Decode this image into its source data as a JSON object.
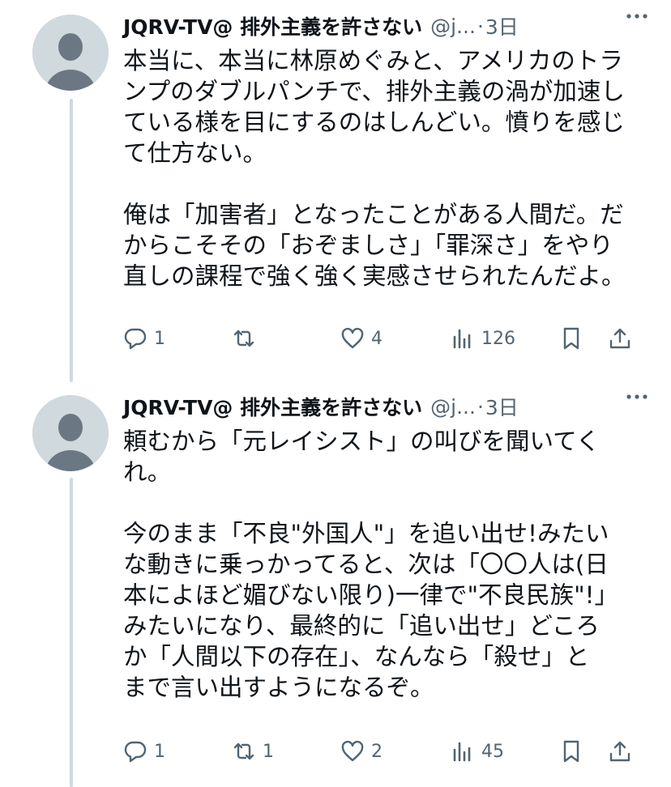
{
  "tweets": [
    {
      "author_name": "JQRV-TV@ 排外主義を許さない",
      "handle": "@j...",
      "separator": "·",
      "time": "3日",
      "lines": [
        "本当に、本当に林原めぐみと、アメリカのトラ",
        "ンプのダブルパンチで、排外主義の渦が加速し",
        "ている様を目にするのはしんどい。憤りを感じ",
        "て仕方ない。",
        "",
        "俺は「加害者」となったことがある人間だ。だ",
        "からこそその「おぞましさ」「罪深さ」をやり",
        "直しの課程で強く強く実感させられたんだよ。"
      ],
      "reply_count": "1",
      "retweet_count": "",
      "like_count": "4",
      "view_count": "126"
    },
    {
      "author_name": "JQRV-TV@ 排外主義を許さない",
      "handle": "@j...",
      "separator": "·",
      "time": "3日",
      "lines": [
        "頼むから「元レイシスト」の叫びを聞いてく",
        "れ。",
        "",
        "今のまま「不良\"外国人\"」を追い出せ!みたい",
        "な動きに乗っかってると、次は「〇〇人は(日",
        "本によほど媚びない限り)一律で\"不良民族\"!」",
        "みたいになり、最終的に「追い出せ」どころ",
        "か「人間以下の存在」、なんなら「殺せ」と",
        "まで言い出すようになるぞ。"
      ],
      "reply_count": "1",
      "retweet_count": "1",
      "like_count": "2",
      "view_count": "45"
    }
  ],
  "colors": {
    "text": "#0f1419",
    "secondary": "#536471",
    "thread_line": "#cfd9de",
    "avatar_bg": "#cfd9de",
    "avatar_fg": "#6b7884"
  },
  "icons": [
    "more-icon",
    "reply-icon",
    "retweet-icon",
    "like-icon",
    "views-icon",
    "bookmark-icon",
    "share-icon"
  ]
}
